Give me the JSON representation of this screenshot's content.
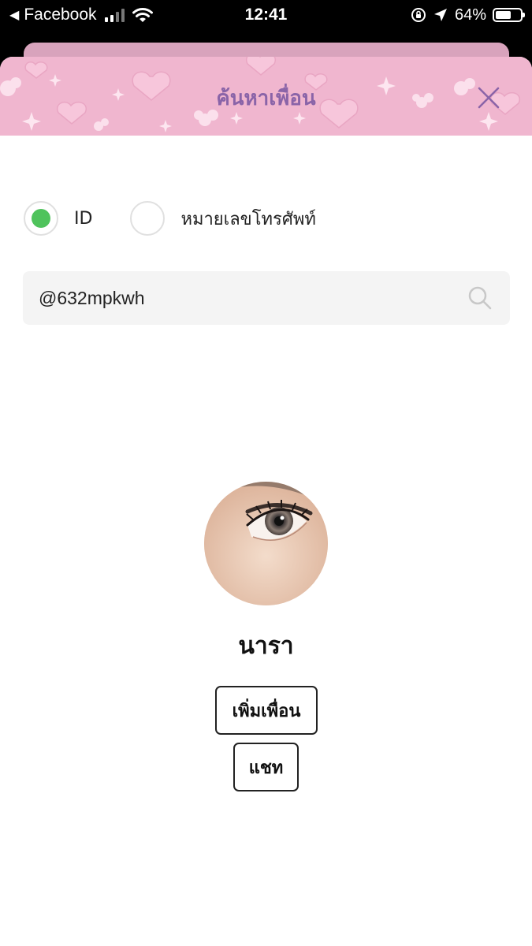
{
  "status_bar": {
    "back_app": "Facebook",
    "time": "12:41",
    "battery": "64%",
    "battery_level": 0.64
  },
  "sheet": {
    "title": "ค้นหาเพื่อน",
    "close_icon": "close-icon",
    "accent": "#8a64a8",
    "header_color": "#f0b6cf"
  },
  "search_type": {
    "options": [
      {
        "label": "ID",
        "selected": true
      },
      {
        "label": "หมายเลขโทรศัพท์",
        "selected": false
      }
    ],
    "selected_color": "#4fc35c"
  },
  "search": {
    "value": "@632mpkwh",
    "icon": "search-icon"
  },
  "result": {
    "name": "นารา",
    "add_friend_label": "เพิ่มเพื่อน",
    "chat_label": "แชท"
  }
}
